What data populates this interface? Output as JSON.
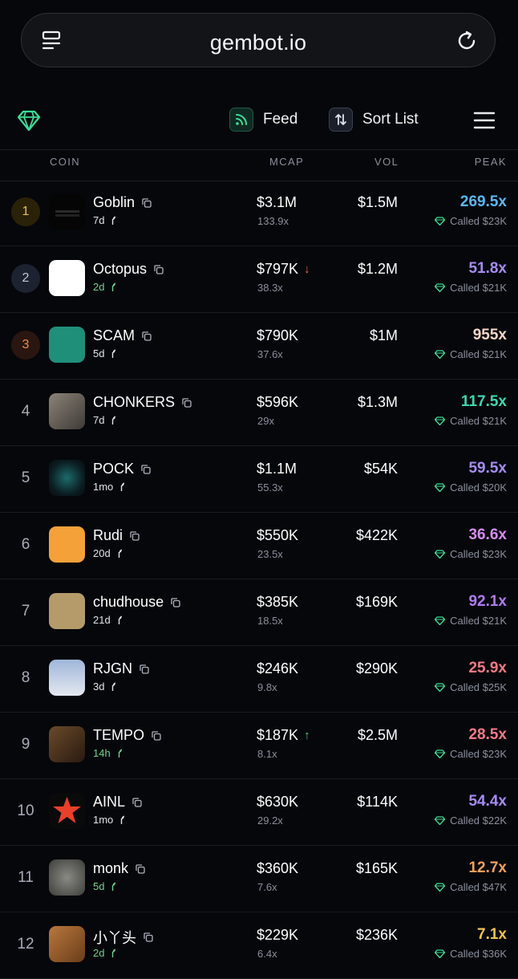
{
  "browser": {
    "url": "gembot.io"
  },
  "header": {
    "feed_label": "Feed",
    "sort_label": "Sort List"
  },
  "table": {
    "columns": {
      "coin": "COIN",
      "mcap": "MCAP",
      "vol": "VOL",
      "peak": "PEAK"
    },
    "rows": [
      {
        "rank": "1",
        "name": "Goblin",
        "age": "7d",
        "mcap": "$3.1M",
        "mult": "133.9x",
        "vol": "$1.5M",
        "peak": "269.5x",
        "called": "Called $23K",
        "peak_color": "#5ab8f5"
      },
      {
        "rank": "2",
        "name": "Octopus",
        "age": "2d",
        "mcap": "$797K",
        "mult": "38.3x",
        "vol": "$1.2M",
        "peak": "51.8x",
        "called": "Called $21K",
        "peak_color": "#a78bf5",
        "trend": "down"
      },
      {
        "rank": "3",
        "name": "SCAM",
        "age": "5d",
        "mcap": "$790K",
        "mult": "37.6x",
        "vol": "$1M",
        "peak": "955x",
        "called": "Called $21K",
        "peak_color": "#f6d6c6"
      },
      {
        "rank": "4",
        "name": "CHONKERS",
        "age": "7d",
        "mcap": "$596K",
        "mult": "29x",
        "vol": "$1.3M",
        "peak": "117.5x",
        "called": "Called $21K",
        "peak_color": "#3fd6b0"
      },
      {
        "rank": "5",
        "name": "POCK",
        "age": "1mo",
        "mcap": "$1.1M",
        "mult": "55.3x",
        "vol": "$54K",
        "peak": "59.5x",
        "called": "Called $20K",
        "peak_color": "#a78bf5"
      },
      {
        "rank": "6",
        "name": "Rudi",
        "age": "20d",
        "mcap": "$550K",
        "mult": "23.5x",
        "vol": "$422K",
        "peak": "36.6x",
        "called": "Called $23K",
        "peak_color": "#d58bf0"
      },
      {
        "rank": "7",
        "name": "chudhouse",
        "age": "21d",
        "mcap": "$385K",
        "mult": "18.5x",
        "vol": "$169K",
        "peak": "92.1x",
        "called": "Called $21K",
        "peak_color": "#b07af5"
      },
      {
        "rank": "8",
        "name": "RJGN",
        "age": "3d",
        "mcap": "$246K",
        "mult": "9.8x",
        "vol": "$290K",
        "peak": "25.9x",
        "called": "Called $25K",
        "peak_color": "#f27a86"
      },
      {
        "rank": "9",
        "name": "TEMPO",
        "age": "14h",
        "mcap": "$187K",
        "mult": "8.1x",
        "vol": "$2.5M",
        "peak": "28.5x",
        "called": "Called $23K",
        "peak_color": "#f27a86",
        "trend": "up"
      },
      {
        "rank": "10",
        "name": "AINL",
        "age": "1mo",
        "mcap": "$630K",
        "mult": "29.2x",
        "vol": "$114K",
        "peak": "54.4x",
        "called": "Called $22K",
        "peak_color": "#a78bf5"
      },
      {
        "rank": "11",
        "name": "monk",
        "age": "5d",
        "mcap": "$360K",
        "mult": "7.6x",
        "vol": "$165K",
        "peak": "12.7x",
        "called": "Called $47K",
        "peak_color": "#f5a05a"
      },
      {
        "rank": "12",
        "name": "小丫头",
        "age": "2d",
        "mcap": "$229K",
        "mult": "6.4x",
        "vol": "$236K",
        "peak": "7.1x",
        "called": "Called $36K",
        "peak_color": "#f5c24a"
      }
    ]
  },
  "colors": {
    "background": "#06070b",
    "accent_green": "#3ddc97",
    "muted": "#8a8f9c"
  }
}
